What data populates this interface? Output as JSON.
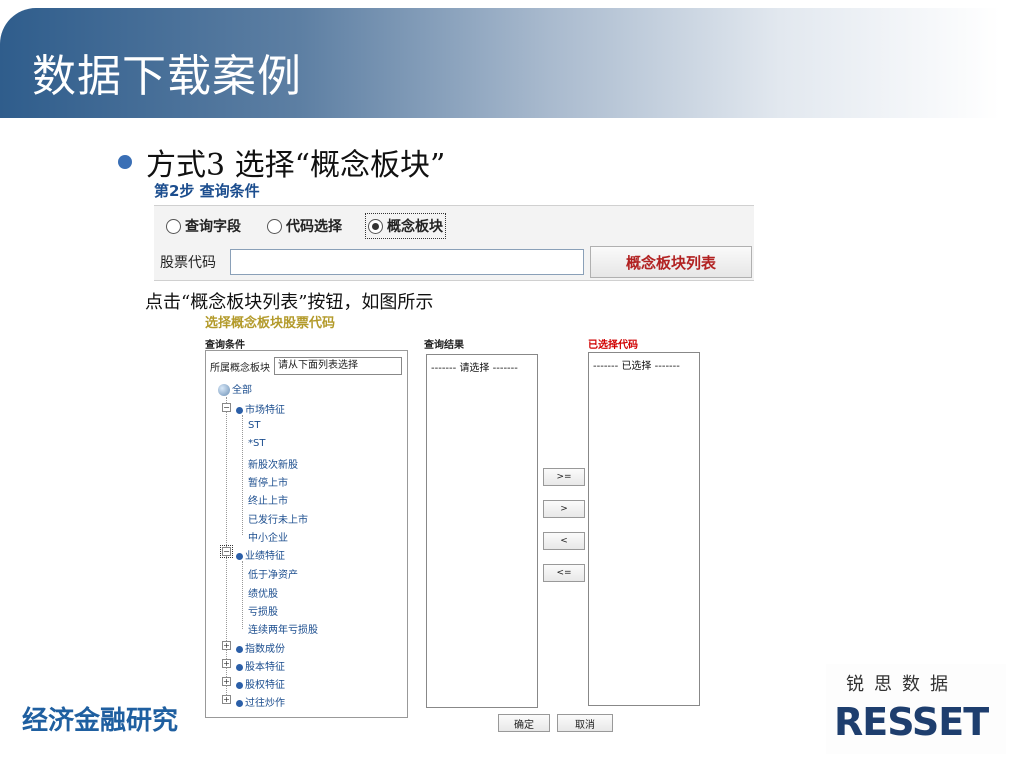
{
  "slide": {
    "title": "数据下载案例",
    "bullet": "方式3   选择“概念板块”",
    "caption": "点击“概念板块列表”按钮，如图所示",
    "footer": "经济金融研究",
    "brand_cn": "锐思数据",
    "brand_logo": "RESSET"
  },
  "step": {
    "title": "第2步 查询条件",
    "radios": [
      {
        "label": "查询字段",
        "selected": false
      },
      {
        "label": "代码选择",
        "selected": false
      },
      {
        "label": "概念板块",
        "selected": true
      }
    ],
    "code_label": "股票代码",
    "code_value": "",
    "concept_button": "概念板块列表"
  },
  "dialog": {
    "title": "选择概念板块股票代码",
    "col_condition": "查询条件",
    "col_result": "查询结果",
    "col_selected": "已选择代码",
    "sector_label": "所属概念板块",
    "sector_value": "请从下面列表选择",
    "tree": {
      "root": "全部",
      "groups": [
        {
          "label": "市场特征",
          "children": [
            "ST",
            "*ST",
            "新股次新股",
            "暂停上市",
            "终止上市",
            "已发行未上市",
            "中小企业"
          ]
        },
        {
          "label": "业绩特征",
          "children": [
            "低于净资产",
            "绩优股",
            "亏损股",
            "连续两年亏损股"
          ]
        },
        {
          "label": "指数成份",
          "children": []
        },
        {
          "label": "股本特征",
          "children": []
        },
        {
          "label": "股权特征",
          "children": []
        },
        {
          "label": "过往炒作",
          "children": []
        }
      ]
    },
    "result_placeholder": "------- 请选择 -------",
    "selected_placeholder": "------- 已选择 -------",
    "move_buttons": [
      ">=",
      ">",
      "<",
      "<="
    ],
    "ok": "确定",
    "cancel": "取消"
  }
}
